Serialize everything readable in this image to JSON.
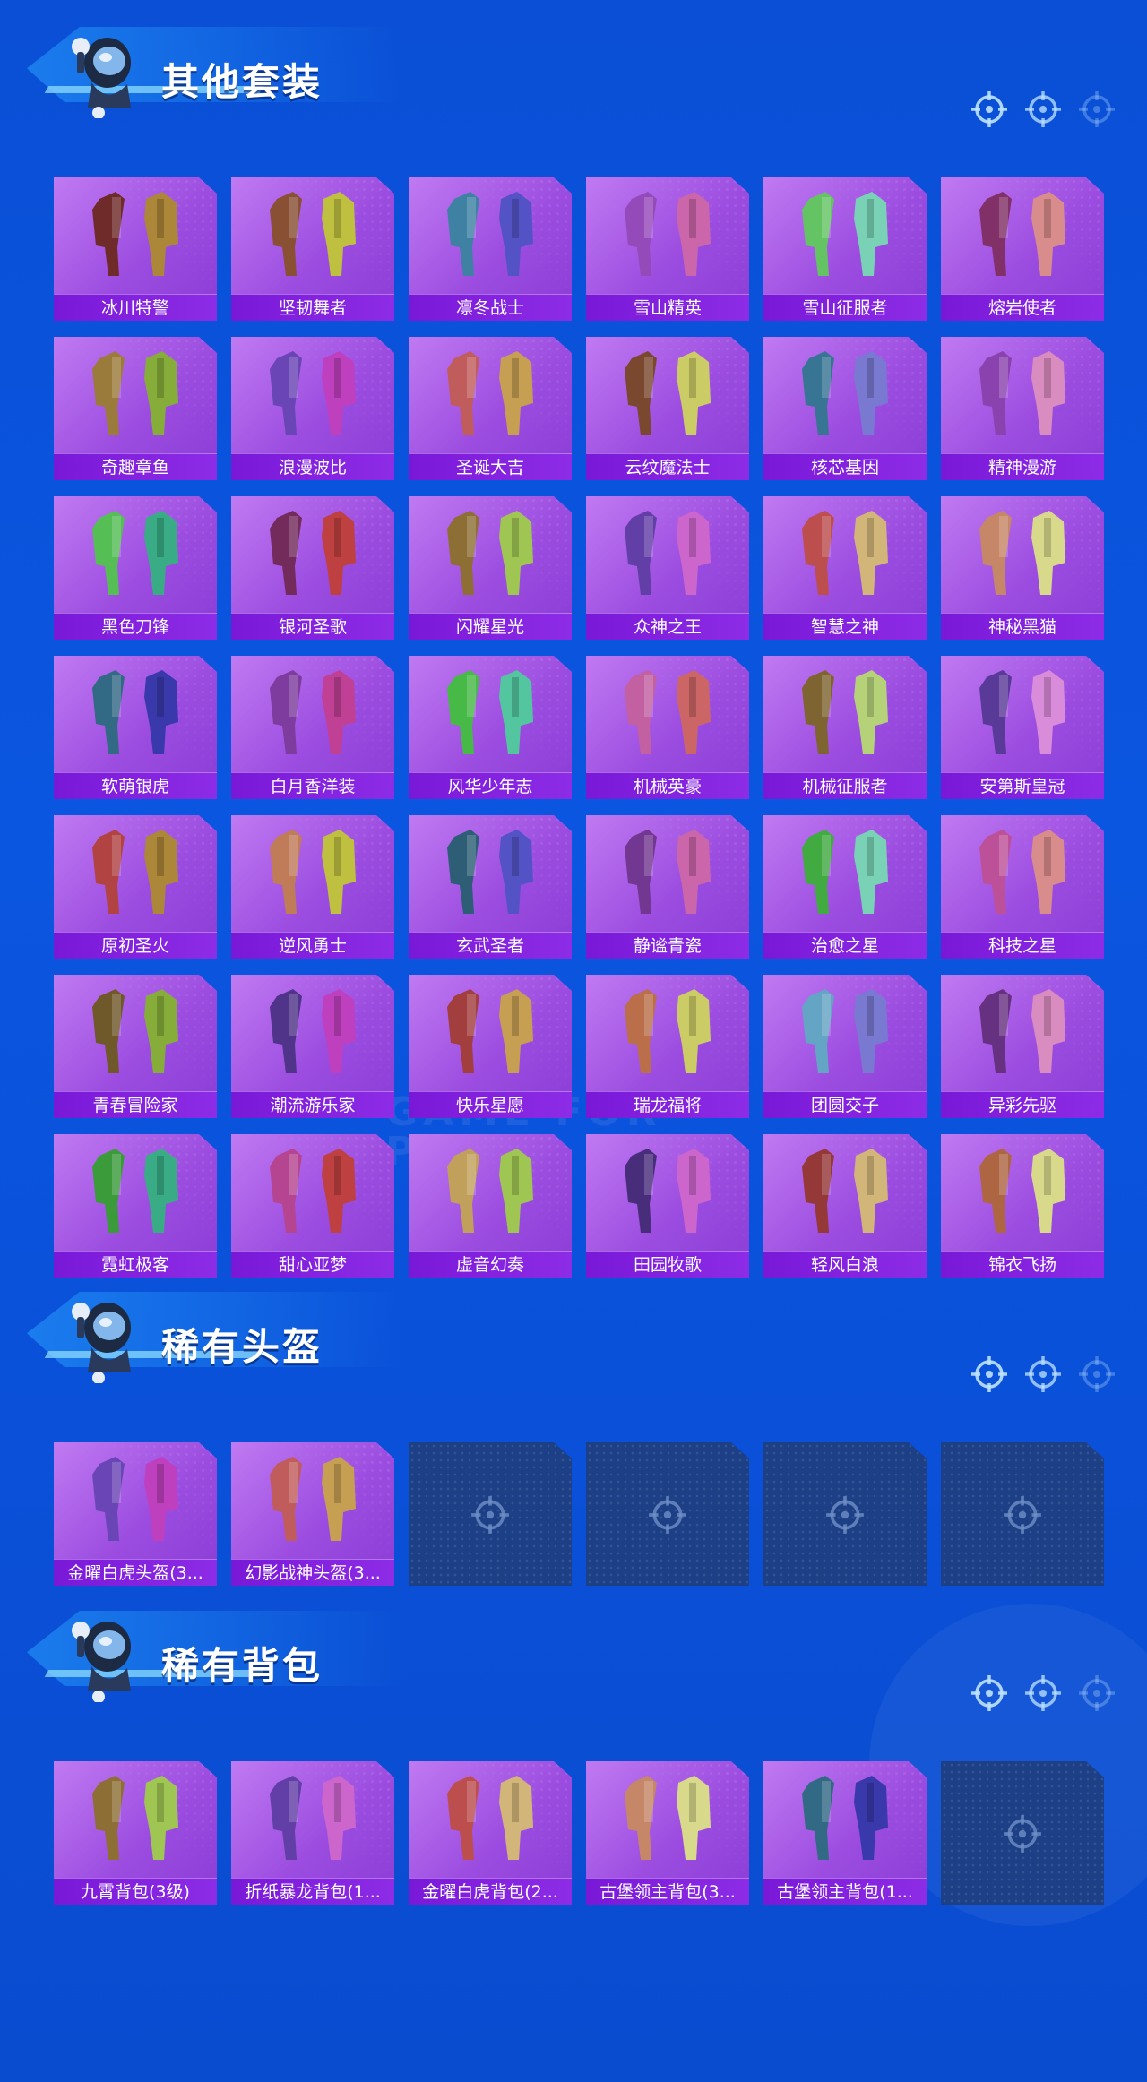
{
  "sections": [
    {
      "title": "其他套装",
      "items": [
        "冰川特警",
        "坚韧舞者",
        "凛冬战士",
        "雪山精英",
        "雪山征服者",
        "熔岩使者",
        "奇趣章鱼",
        "浪漫波比",
        "圣诞大吉",
        "云纹魔法士",
        "核芯基因",
        "精神漫游",
        "黑色刀锋",
        "银河圣歌",
        "闪耀星光",
        "众神之王",
        "智慧之神",
        "神秘黑猫",
        "软萌银虎",
        "白月香洋装",
        "风华少年志",
        "机械英豪",
        "机械征服者",
        "安第斯皇冠",
        "原初圣火",
        "逆风勇士",
        "玄武圣者",
        "静谧青瓷",
        "治愈之星",
        "科技之星",
        "青春冒险家",
        "潮流游乐家",
        "快乐星愿",
        "瑞龙福将",
        "团圆交子",
        "异彩先驱",
        "霓虹极客",
        "甜心亚梦",
        "虚音幻奏",
        "田园牧歌",
        "轻风白浪",
        "锦衣飞扬"
      ],
      "empty_slots": 0
    },
    {
      "title": "稀有头盔",
      "items": [
        "金曜白虎头盔(3...",
        "幻影战神头盔(3..."
      ],
      "empty_slots": 4
    },
    {
      "title": "稀有背包",
      "items": [
        "九霄背包(3级)",
        "折纸暴龙背包(1...",
        "金曜白虎背包(2...",
        "古堡领主背包(3...",
        "古堡领主背包(1..."
      ],
      "empty_slots": 1
    }
  ],
  "watermark": "GAME FOR PEACE",
  "colors": {
    "background": "#0a4fd6",
    "card": "#a55ee6",
    "label_bar": "#8420e0",
    "empty_slot": "#1c3f86"
  },
  "icons": {
    "section_mascot": "mascot-icon",
    "section_decoration": "crosshair-icon",
    "empty_slot": "crosshair-icon"
  }
}
